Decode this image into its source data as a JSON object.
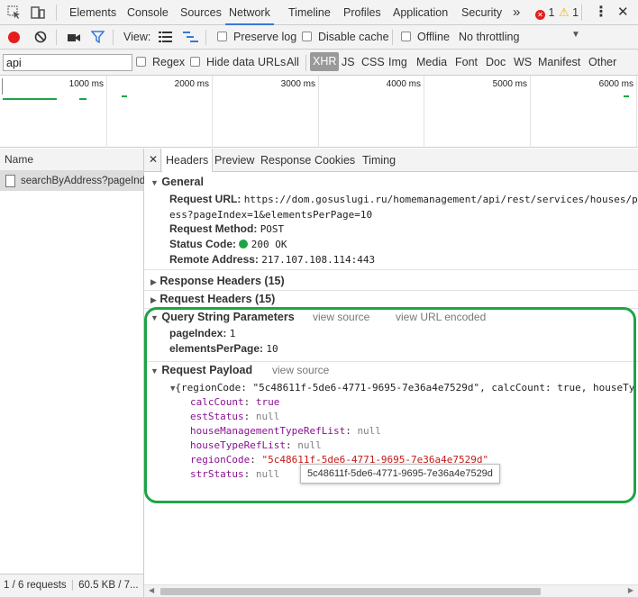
{
  "tabs": [
    "Elements",
    "Console",
    "Sources",
    "Network",
    "Timeline",
    "Profiles",
    "Application",
    "Security"
  ],
  "more_tabs": "»",
  "error_count": "1",
  "warning_count": "1",
  "toolbar": {
    "view_label": "View:",
    "preserve_log": "Preserve log",
    "disable_cache": "Disable cache",
    "offline": "Offline",
    "throttling": "No throttling"
  },
  "filter": {
    "value": "api",
    "regex": "Regex",
    "hide_data_urls": "Hide data URLs",
    "types": [
      "All",
      "XHR",
      "JS",
      "CSS",
      "Img",
      "Media",
      "Font",
      "Doc",
      "WS",
      "Manifest",
      "Other"
    ],
    "active_type": "XHR"
  },
  "timeline_ticks": [
    "1000 ms",
    "2000 ms",
    "3000 ms",
    "4000 ms",
    "5000 ms",
    "6000 ms"
  ],
  "requests": {
    "name_header": "Name",
    "items": [
      "searchByAddress?pageInd..."
    ],
    "status": "1 / 6 requests",
    "size": "60.5 KB / 7..."
  },
  "detail_tabs": [
    "Headers",
    "Preview",
    "Response",
    "Cookies",
    "Timing"
  ],
  "general": {
    "title": "General",
    "request_url_label": "Request URL:",
    "request_url_line1": "https://dom.gosuslugi.ru/homemanagement/api/rest/services/houses/pu",
    "request_url_line2": "ess?pageIndex=1&elementsPerPage=10",
    "method_label": "Request Method:",
    "method": "POST",
    "status_label": "Status Code:",
    "status": "200 OK",
    "status_color": "#1ea446",
    "remote_label": "Remote Address:",
    "remote": "217.107.108.114:443"
  },
  "response_headers": "Response Headers (15)",
  "request_headers": "Request Headers (15)",
  "query": {
    "title": "Query String Parameters",
    "view_source": "view source",
    "view_url_encoded": "view URL encoded",
    "params": [
      {
        "key": "pageIndex:",
        "value": "1"
      },
      {
        "key": "elementsPerPage:",
        "value": "10"
      }
    ]
  },
  "payload": {
    "title": "Request Payload",
    "view_source": "view source",
    "summary": "{regionCode: \"5c48611f-5de6-4771-9695-7e36a4e7529d\", calcCount: true, houseTy",
    "props": [
      {
        "key": "calcCount",
        "value": "true",
        "kind": "kw"
      },
      {
        "key": "estStatus",
        "value": "null",
        "kind": "nul"
      },
      {
        "key": "houseManagementTypeRefList",
        "value": "null",
        "kind": "nul"
      },
      {
        "key": "houseTypeRefList",
        "value": "null",
        "kind": "nul"
      },
      {
        "key": "regionCode",
        "value": "\"5c48611f-5de6-4771-9695-7e36a4e7529d\"",
        "kind": "str"
      },
      {
        "key": "strStatus",
        "value": "null",
        "kind": "nul"
      }
    ],
    "tooltip": "5c48611f-5de6-4771-9695-7e36a4e7529d"
  },
  "colors": {
    "highlight_ring": "#1ea446",
    "accent": "#3879d9",
    "record": "#e41e1e"
  }
}
